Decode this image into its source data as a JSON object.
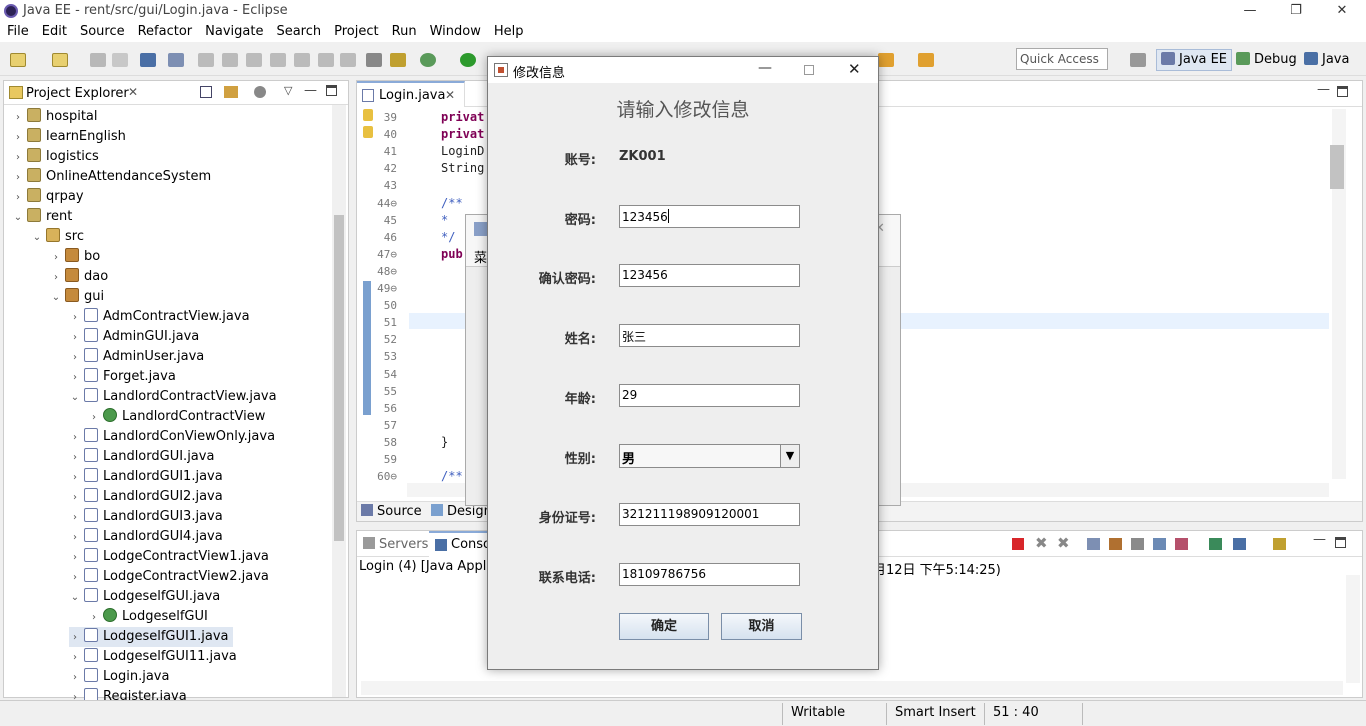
{
  "window": {
    "title": "Java EE - rent/src/gui/Login.java - Eclipse",
    "min": "—",
    "restore": "❐",
    "close": "✕"
  },
  "menu": [
    "File",
    "Edit",
    "Source",
    "Refactor",
    "Navigate",
    "Search",
    "Project",
    "Run",
    "Window",
    "Help"
  ],
  "toolbar": {
    "quick_access_placeholder": "Quick Access"
  },
  "perspectives": [
    {
      "label": "Java EE",
      "icon": "java-ee-perspective-icon"
    },
    {
      "label": "Debug",
      "icon": "debug-perspective-icon"
    },
    {
      "label": "Java",
      "icon": "java-perspective-icon"
    }
  ],
  "project_explorer": {
    "title": "Project Explorer",
    "items": [
      {
        "label": "hospital",
        "depth": 0,
        "twisty": "›",
        "icon": "proj"
      },
      {
        "label": "learnEnglish",
        "depth": 0,
        "twisty": "›",
        "icon": "proj"
      },
      {
        "label": "logistics",
        "depth": 0,
        "twisty": "›",
        "icon": "proj"
      },
      {
        "label": "OnlineAttendanceSystem",
        "depth": 0,
        "twisty": "›",
        "icon": "proj"
      },
      {
        "label": "qrpay",
        "depth": 0,
        "twisty": "›",
        "icon": "proj"
      },
      {
        "label": "rent",
        "depth": 0,
        "twisty": "⌄",
        "icon": "proj"
      },
      {
        "label": "src",
        "depth": 1,
        "twisty": "⌄",
        "icon": "src"
      },
      {
        "label": "bo",
        "depth": 2,
        "twisty": "›",
        "icon": "pkg"
      },
      {
        "label": "dao",
        "depth": 2,
        "twisty": "›",
        "icon": "pkg"
      },
      {
        "label": "gui",
        "depth": 2,
        "twisty": "⌄",
        "icon": "pkg"
      },
      {
        "label": "AdmContractView.java",
        "depth": 3,
        "twisty": "›",
        "icon": "java"
      },
      {
        "label": "AdminGUI.java",
        "depth": 3,
        "twisty": "›",
        "icon": "java"
      },
      {
        "label": "AdminUser.java",
        "depth": 3,
        "twisty": "›",
        "icon": "java"
      },
      {
        "label": "Forget.java",
        "depth": 3,
        "twisty": "›",
        "icon": "java"
      },
      {
        "label": "LandlordContractView.java",
        "depth": 3,
        "twisty": "⌄",
        "icon": "java"
      },
      {
        "label": "LandlordContractView",
        "depth": 4,
        "twisty": "›",
        "icon": "cls"
      },
      {
        "label": "LandlordConViewOnly.java",
        "depth": 3,
        "twisty": "›",
        "icon": "java"
      },
      {
        "label": "LandlordGUI.java",
        "depth": 3,
        "twisty": "›",
        "icon": "java"
      },
      {
        "label": "LandlordGUI1.java",
        "depth": 3,
        "twisty": "›",
        "icon": "java"
      },
      {
        "label": "LandlordGUI2.java",
        "depth": 3,
        "twisty": "›",
        "icon": "java"
      },
      {
        "label": "LandlordGUI3.java",
        "depth": 3,
        "twisty": "›",
        "icon": "java"
      },
      {
        "label": "LandlordGUI4.java",
        "depth": 3,
        "twisty": "›",
        "icon": "java"
      },
      {
        "label": "LodgeContractView1.java",
        "depth": 3,
        "twisty": "›",
        "icon": "java"
      },
      {
        "label": "LodgeContractView2.java",
        "depth": 3,
        "twisty": "›",
        "icon": "java"
      },
      {
        "label": "LodgeselfGUI.java",
        "depth": 3,
        "twisty": "⌄",
        "icon": "java"
      },
      {
        "label": "LodgeselfGUI",
        "depth": 4,
        "twisty": "›",
        "icon": "cls"
      },
      {
        "label": "LodgeselfGUI1.java",
        "depth": 3,
        "twisty": "›",
        "icon": "java",
        "selected": true
      },
      {
        "label": "LodgeselfGUI11.java",
        "depth": 3,
        "twisty": "›",
        "icon": "java"
      },
      {
        "label": "Login.java",
        "depth": 3,
        "twisty": "›",
        "icon": "java"
      },
      {
        "label": "Register.java",
        "depth": 3,
        "twisty": "›",
        "icon": "java"
      }
    ]
  },
  "editor": {
    "tab": "Login.java",
    "lines": [
      {
        "n": "39",
        "code": "privat"
      },
      {
        "n": "40",
        "code": "privat"
      },
      {
        "n": "41",
        "code": "LoginD"
      },
      {
        "n": "42",
        "code": "String"
      },
      {
        "n": "43",
        "code": ""
      },
      {
        "n": "44⊖",
        "code": "/**"
      },
      {
        "n": "45",
        "code": " *"
      },
      {
        "n": "46",
        "code": " */"
      },
      {
        "n": "47⊖",
        "code": "pub"
      },
      {
        "n": "48⊖",
        "code": ""
      },
      {
        "n": "49⊖",
        "code": ""
      },
      {
        "n": "50",
        "code": ""
      },
      {
        "n": "51",
        "code": ""
      },
      {
        "n": "52",
        "code": ""
      },
      {
        "n": "53",
        "code": ""
      },
      {
        "n": "54",
        "code": ""
      },
      {
        "n": "55",
        "code": ""
      },
      {
        "n": "56",
        "code": ""
      },
      {
        "n": "57",
        "code": ""
      },
      {
        "n": "58",
        "code": "}"
      },
      {
        "n": "59",
        "code": ""
      },
      {
        "n": "60⊖",
        "code": "/**"
      }
    ],
    "bottom_tabs": [
      "Source",
      "Design"
    ]
  },
  "console": {
    "tabs": [
      "Servers",
      "Conso"
    ],
    "line_left": "Login (4) [Java Applica",
    "line_right": "月12日 下午5:14:25)"
  },
  "bg_dialog": {
    "text": "菜"
  },
  "dialog": {
    "title": "修改信息",
    "heading": "请输入修改信息",
    "account_label": "账号:",
    "account_value": "ZK001",
    "fields": [
      {
        "label": "密码:",
        "value": "123456"
      },
      {
        "label": "确认密码:",
        "value": "123456"
      },
      {
        "label": "姓名:",
        "value": "张三"
      },
      {
        "label": "年龄:",
        "value": "29"
      },
      {
        "label": "性别:",
        "value": "男",
        "type": "select"
      },
      {
        "label": "身份证号:",
        "value": "321211198909120001"
      },
      {
        "label": "联系电话:",
        "value": "18109786756"
      }
    ],
    "ok": "确定",
    "cancel": "取消"
  },
  "status": {
    "writable": "Writable",
    "insert": "Smart Insert",
    "position": "51 : 40"
  }
}
